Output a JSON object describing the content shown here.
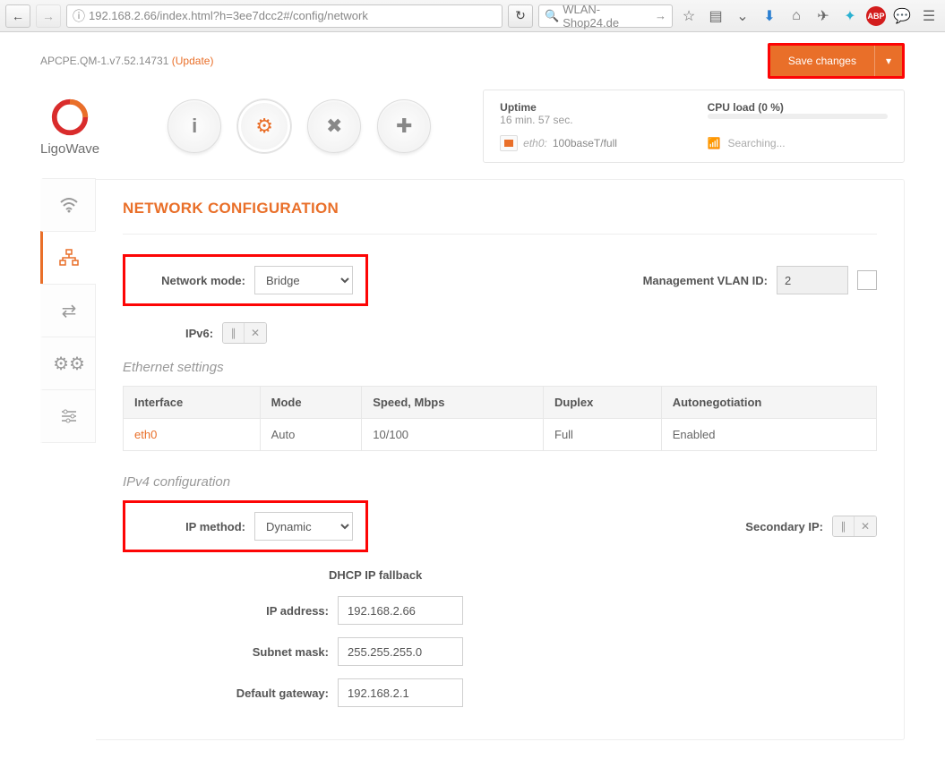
{
  "browser": {
    "url": "192.168.2.66/index.html?h=3ee7dcc2#/config/network",
    "search_placeholder": "WLAN-Shop24.de"
  },
  "topbar": {
    "firmware": "APCPE.QM-1.v7.52.14731",
    "update": "(Update)",
    "save": "Save changes"
  },
  "logo": {
    "text": "LigoWave"
  },
  "stats": {
    "uptime_label": "Uptime",
    "uptime_value": "16 min. 57 sec.",
    "cpu_label": "CPU load (0 %)",
    "eth_if": "eth0:",
    "eth_val": "100baseT/full",
    "wifi_status": "Searching..."
  },
  "page": {
    "title": "NETWORK CONFIGURATION",
    "network_mode_label": "Network mode:",
    "network_mode_value": "Bridge",
    "vlan_label": "Management VLAN ID:",
    "vlan_value": "2",
    "ipv6_label": "IPv6:",
    "eth_section": "Ethernet settings",
    "eth_headers": {
      "if": "Interface",
      "mode": "Mode",
      "speed": "Speed, Mbps",
      "duplex": "Duplex",
      "auto": "Autonegotiation"
    },
    "eth_row": {
      "if": "eth0",
      "mode": "Auto",
      "speed": "10/100",
      "duplex": "Full",
      "auto": "Enabled"
    },
    "ipv4_section": "IPv4 configuration",
    "ip_method_label": "IP method:",
    "ip_method_value": "Dynamic",
    "secondary_ip_label": "Secondary IP:",
    "dhcp_fb": "DHCP IP fallback",
    "ip_addr_label": "IP address:",
    "ip_addr_value": "192.168.2.66",
    "mask_label": "Subnet mask:",
    "mask_value": "255.255.255.0",
    "gw_label": "Default gateway:",
    "gw_value": "192.168.2.1"
  }
}
